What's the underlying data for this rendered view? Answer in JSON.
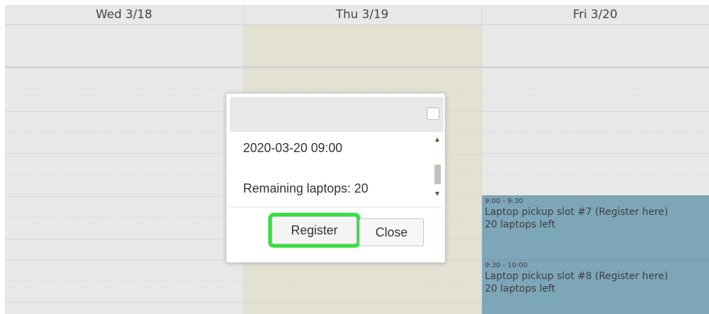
{
  "calendar": {
    "columns": [
      {
        "label": "Wed 3/18"
      },
      {
        "label": "Thu 3/19"
      },
      {
        "label": "Fri 3/20"
      }
    ],
    "events": [
      {
        "time": "9:00 - 9:30",
        "title": "Laptop pickup slot #7 (Register here)",
        "desc": "20 laptops left"
      },
      {
        "time": "9:30 - 10:00",
        "title": "Laptop pickup slot #8 (Register here)",
        "desc": "20 laptops left"
      }
    ],
    "colors": {
      "today_bg": "#e3e1d2",
      "event_bg": "#7da6b9",
      "highlight": "#35e03f"
    }
  },
  "popup": {
    "datetime": "2020-03-20 09:00",
    "remaining": "Remaining laptops: 20",
    "register_label": "Register",
    "close_label": "Close",
    "icons": {
      "checkbox": "checkbox-icon",
      "up": "scroll-up-icon",
      "down": "scroll-down-icon"
    }
  }
}
